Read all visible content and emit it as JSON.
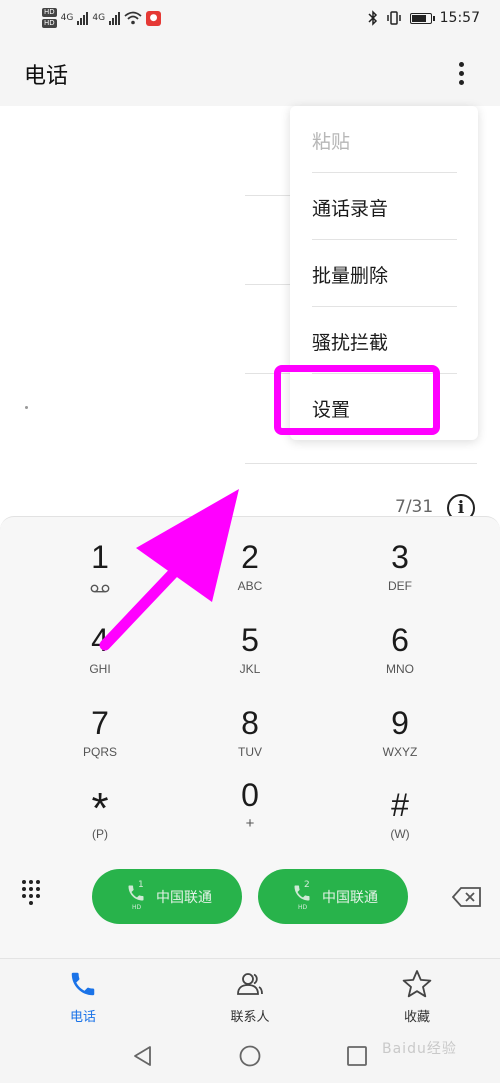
{
  "status_bar": {
    "hd_label": "HD",
    "network_1": "4G",
    "network_2": "4G",
    "battery_level": 0.85,
    "time": "15:57"
  },
  "header": {
    "title": "电话",
    "more_icon": "more-vertical-icon"
  },
  "menu": {
    "items": [
      {
        "label": "粘贴",
        "enabled": false
      },
      {
        "label": "通话录音",
        "enabled": true
      },
      {
        "label": "批量删除",
        "enabled": true
      },
      {
        "label": "骚扰拦截",
        "enabled": true
      },
      {
        "label": "设置",
        "enabled": true,
        "highlighted": true
      }
    ],
    "highlight_color": "#ff00ff"
  },
  "log": {
    "count": "7/31",
    "info_icon": "info-icon"
  },
  "keypad": {
    "keys": [
      {
        "digit": "1",
        "letters": ""
      },
      {
        "digit": "2",
        "letters": "ABC"
      },
      {
        "digit": "3",
        "letters": "DEF"
      },
      {
        "digit": "4",
        "letters": "GHI"
      },
      {
        "digit": "5",
        "letters": "JKL"
      },
      {
        "digit": "6",
        "letters": "MNO"
      },
      {
        "digit": "7",
        "letters": "PQRS"
      },
      {
        "digit": "8",
        "letters": "TUV"
      },
      {
        "digit": "9",
        "letters": "WXYZ"
      },
      {
        "digit": "*",
        "letters": "(P)"
      },
      {
        "digit": "0",
        "letters": "+"
      },
      {
        "digit": "#",
        "letters": "(W)"
      }
    ]
  },
  "call_buttons": [
    {
      "sim": "1",
      "hd": "HD",
      "carrier": "中国联通"
    },
    {
      "sim": "2",
      "hd": "HD",
      "carrier": "中国联通"
    }
  ],
  "bottom_nav": {
    "tabs": [
      {
        "label": "电话",
        "icon": "phone-icon",
        "active": true
      },
      {
        "label": "联系人",
        "icon": "contacts-icon",
        "active": false
      },
      {
        "label": "收藏",
        "icon": "star-icon",
        "active": false
      }
    ]
  },
  "system_nav": {
    "back": "back-icon",
    "home": "home-icon",
    "recents": "recents-icon"
  },
  "watermark": "Baidu经验",
  "colors": {
    "accent": "#1a73e8",
    "call_green": "#28b34b",
    "annotation": "#ff00ff"
  }
}
